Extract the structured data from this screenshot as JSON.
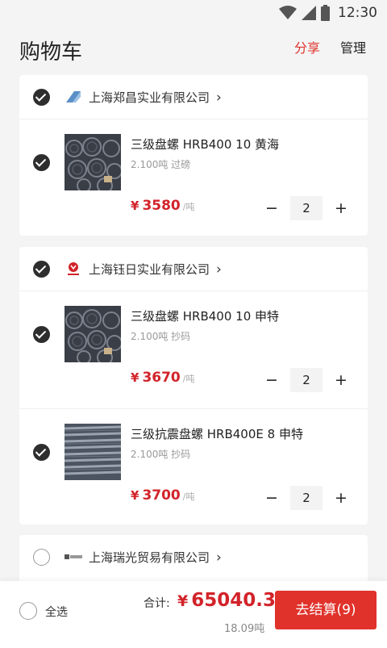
{
  "status": {
    "time": "12:30"
  },
  "header": {
    "title": "购物车",
    "share": "分享",
    "manage": "管理"
  },
  "shops": [
    {
      "name": "上海郑昌实业有限公司",
      "logo": "zhengchang-logo",
      "items": [
        {
          "title": "三级盘螺 HRB400 10 黄海",
          "sub": "2.100吨 过磅",
          "price_symbol": "¥",
          "price": "3580",
          "unit": "/吨",
          "qty": "2",
          "thumb": "coil-rebar"
        }
      ]
    },
    {
      "name": "上海钰日实业有限公司",
      "logo": "yuri-logo",
      "items": [
        {
          "title": "三级盘螺 HRB400 10 申特",
          "sub": "2.100吨 抄码",
          "price_symbol": "¥",
          "price": "3670",
          "unit": "/吨",
          "qty": "2",
          "thumb": "coil-rebar"
        },
        {
          "title": "三级抗震盘螺 HRB400E 8 申特",
          "sub": "2.100吨 抄码",
          "price_symbol": "¥",
          "price": "3700",
          "unit": "/吨",
          "qty": "2",
          "thumb": "straight-rebar"
        }
      ]
    },
    {
      "name": "上海瑞光贸易有限公司",
      "logo": "ruiguang-logo",
      "items": []
    }
  ],
  "stepper": {
    "minus": "−",
    "plus": "+"
  },
  "chevron": "›",
  "bottom": {
    "select_all": "全选",
    "total_label": "合计:",
    "total_symbol": "¥",
    "total_value": "65040.3",
    "total_weight": "18.09吨",
    "checkout": "去结算(9)"
  },
  "colors": {
    "accent": "#e0322b",
    "price": "#d2232a"
  }
}
